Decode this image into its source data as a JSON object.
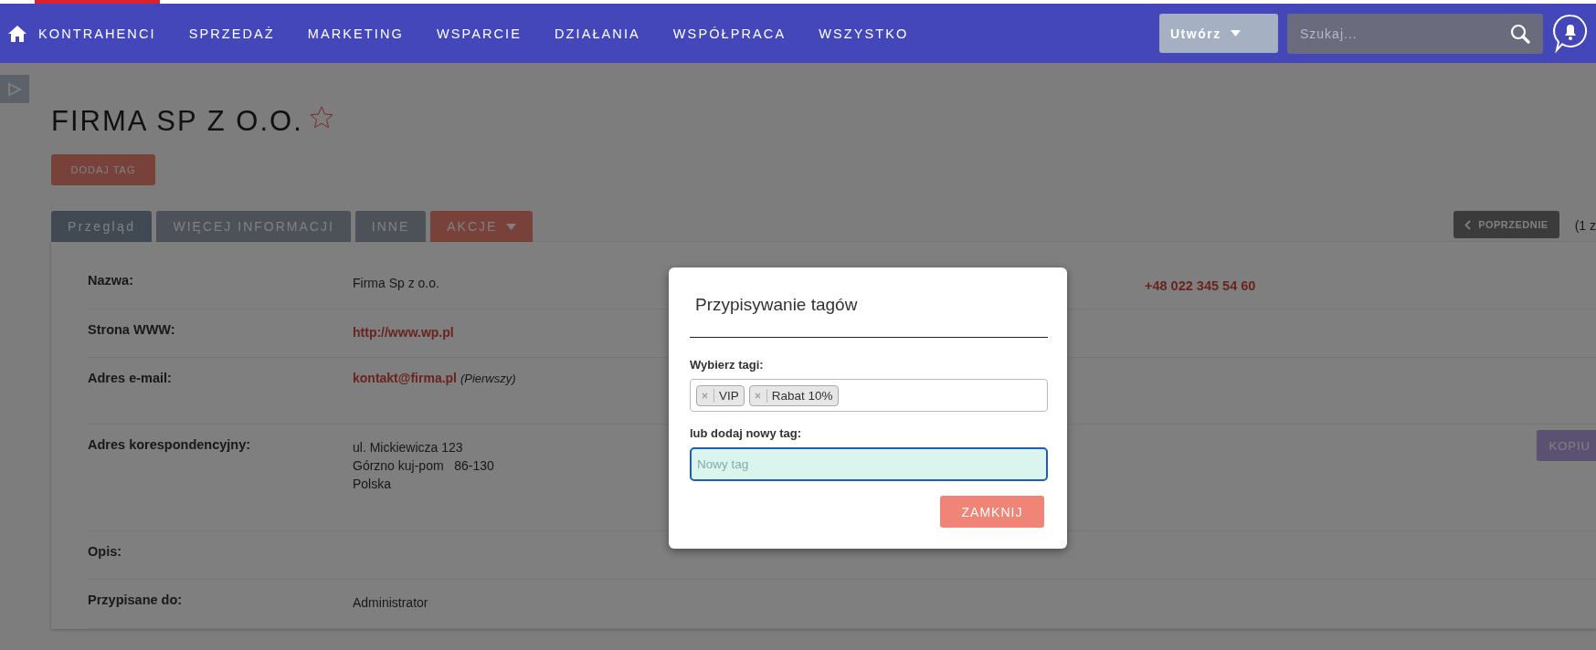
{
  "navbar": {
    "items": [
      {
        "label": "KONTRAHENCI",
        "selected": true
      },
      {
        "label": "SPRZEDAŻ",
        "selected": false
      },
      {
        "label": "MARKETING",
        "selected": false
      },
      {
        "label": "WSPARCIE",
        "selected": false
      },
      {
        "label": "DZIAŁANIA",
        "selected": false
      },
      {
        "label": "WSPÓŁPRACA",
        "selected": false
      },
      {
        "label": "WSZYSTKO",
        "selected": false
      }
    ],
    "create_button": "Utwórz",
    "search": {
      "placeholder": "Szukaj..."
    }
  },
  "record": {
    "title": "FIRMA SP Z O.O.",
    "starred": false,
    "add_tag_button": "DODAJ TAG",
    "tabs": [
      {
        "label": "Przegląd",
        "selected": true,
        "kind": "tab"
      },
      {
        "label": "WIĘCEJ INFORMACJI",
        "selected": false,
        "kind": "tab"
      },
      {
        "label": "INNE",
        "selected": false,
        "kind": "tab"
      },
      {
        "label": "AKCJE",
        "selected": false,
        "kind": "dropdown"
      }
    ],
    "previous_button": "POPRZEDNIE",
    "pager": "(1 z",
    "fields": [
      {
        "label": "Nazwa:",
        "kind": "text",
        "value": "Firma Sp z o.o."
      },
      {
        "label": "Strona WWW:",
        "kind": "link",
        "value": "http://www.wp.pl"
      },
      {
        "label": "Adres e-mail:",
        "kind": "email",
        "value": "kontakt@firma.pl",
        "note": "(Pierwszy)"
      },
      {
        "label": "Adres korespondencyjny:",
        "kind": "address",
        "lines": [
          "ul. Mickiewicza 123",
          "Górzno kuj-pom   86-130",
          "Polska"
        ]
      },
      {
        "label": "Opis:",
        "kind": "text"
      },
      {
        "label": "Przypisane do:",
        "kind": "text",
        "value": "Administrator"
      }
    ],
    "phone": "+48 022 345 54 60",
    "copy_button": "KOPIU"
  },
  "modal": {
    "title": "Przypisywanie tagów",
    "select_label": "Wybierz tagi:",
    "tags": [
      "VIP",
      "Rabat 10%"
    ],
    "new_tag_label": "lub dodaj nowy tag:",
    "new_tag": {
      "placeholder": "Nowy tag"
    },
    "close_button": "ZAMKNIJ"
  }
}
